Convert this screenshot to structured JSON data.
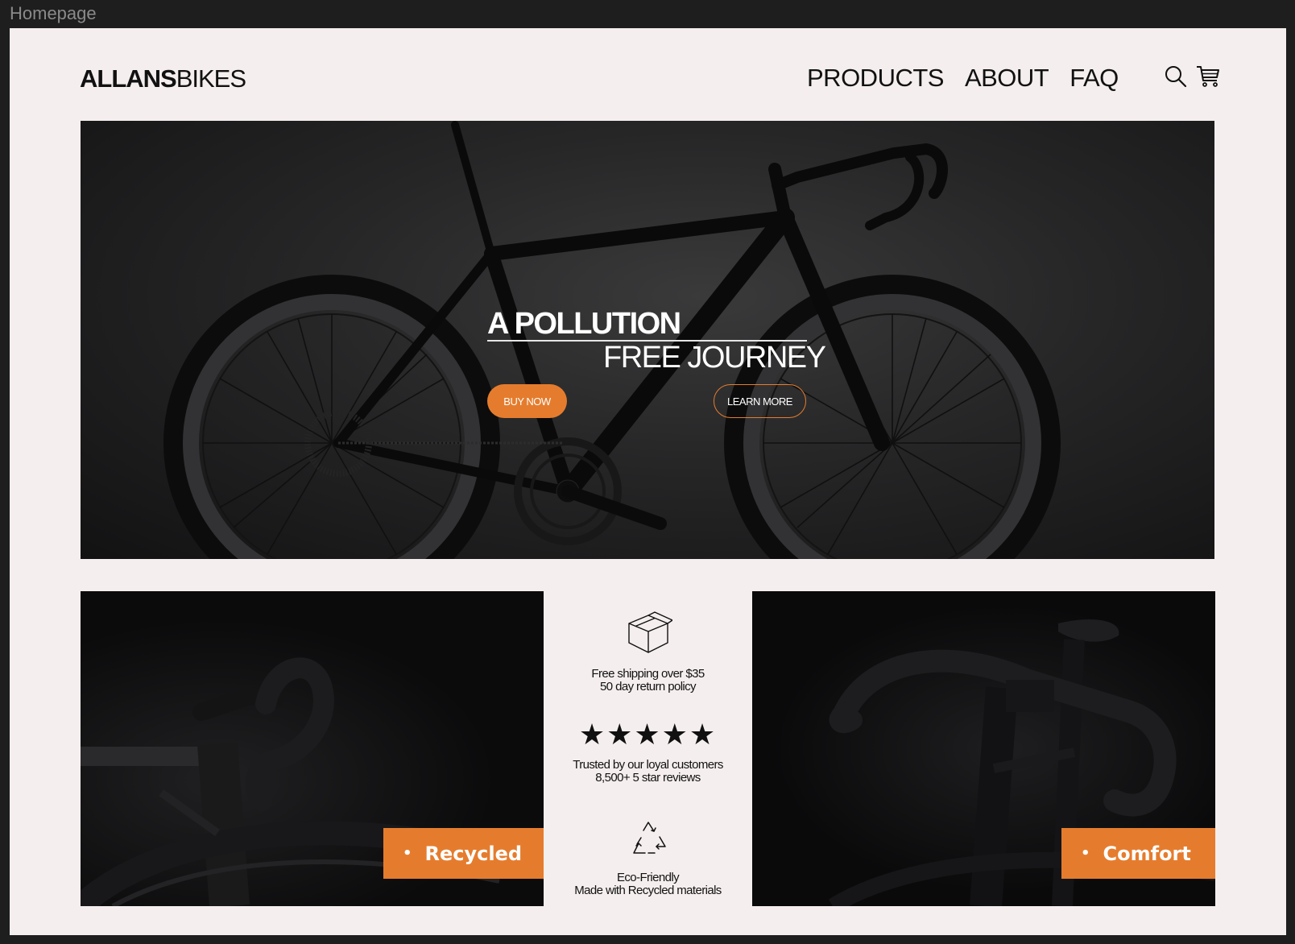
{
  "frame_label": "Homepage",
  "header": {
    "logo_bold": "ALLANS",
    "logo_light": "BIKES",
    "nav": [
      "PRODUCTS",
      "ABOUT",
      "FAQ"
    ]
  },
  "hero": {
    "title_line1": "A POLLUTION",
    "title_line2": "FREE JOURNEY",
    "buy_label": "BUY NOW",
    "learn_label": "LEARN MORE"
  },
  "features": [
    {
      "icon": "box-icon",
      "line1": "Free shipping over $35",
      "line2": "50 day return policy"
    },
    {
      "icon": "stars-icon",
      "stars": "★★★★★",
      "line1": "Trusted by our loyal customers",
      "line2": "8,500+ 5 star reviews"
    },
    {
      "icon": "recycle-icon",
      "line1": "Eco-Friendly",
      "line2": "Made with Recycled materials"
    }
  ],
  "panels": {
    "left_badge": "Recycled",
    "right_badge": "Comfort",
    "bullet": "•"
  },
  "colors": {
    "accent": "#e57c2d",
    "page_bg": "#f5eeee",
    "canvas_bg": "#1e1e1e"
  }
}
